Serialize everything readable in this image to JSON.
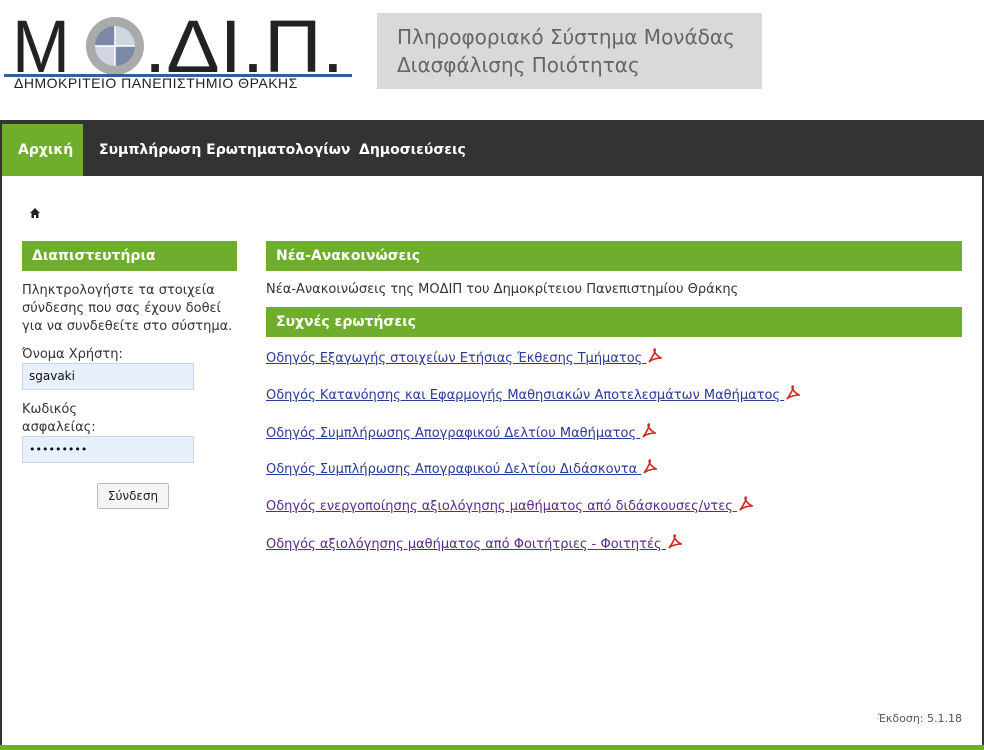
{
  "header": {
    "logo_text": "Μ.ΔΙ.Π.",
    "logo_subtitle": "ΔΗΜΟΚΡΙΤΕΙΟ ΠΑΝΕΠΙΣΤΗΜΙΟ ΘΡΑΚΗΣ",
    "system_title_line1": "Πληροφοριακό Σύστημα Μονάδας",
    "system_title_line2": "Διασφάλισης Ποιότητας"
  },
  "nav": {
    "items": [
      {
        "label": "Αρχική",
        "active": true
      },
      {
        "label": "Συμπλήρωση Ερωτηματολογίων",
        "active": false
      },
      {
        "label": "Δημοσιεύσεις",
        "active": false
      }
    ]
  },
  "breadcrumb": {
    "home_icon": "home-icon"
  },
  "login": {
    "title": "Διαπιστευτήρια",
    "intro": "Πληκτρολογήστε τα στοιχεία σύνδεσης που σας έχουν δοθεί για να συνδεθείτε στο σύστημα.",
    "username_label": "Όνομα Χρήστη:",
    "username_value": "sgavaki",
    "password_label_line1": "Κωδικός",
    "password_label_line2": "ασφαλείας:",
    "password_value": "•••••••••",
    "submit_label": "Σύνδεση"
  },
  "announcements": {
    "title": "Νέα-Ανακοινώσεις",
    "text": "Νέα-Ανακοινώσεις της ΜΟΔΙΠ του Δημοκρίτειου Πανεπιστημίου Θράκης"
  },
  "faq": {
    "title": "Συχνές ερωτήσεις",
    "links": [
      {
        "label": "Οδηγός Εξαγωγής στοιχείων Ετήσιας Έκθεσης Τμήματος",
        "icon": "pdf-icon",
        "visited": false
      },
      {
        "label": "Οδηγός Κατανόησης και Εφαρμογής Μαθησιακών Αποτελεσμάτων Μαθήματος",
        "icon": "pdf-icon",
        "visited": false
      },
      {
        "label": "Οδηγός Συμπλήρωσης Απογραφικού Δελτίου Μαθήματος",
        "icon": "pdf-icon",
        "visited": false
      },
      {
        "label": "Οδηγός Συμπλήρωσης Απογραφικού Δελτίου Διδάσκοντα",
        "icon": "pdf-icon",
        "visited": false
      },
      {
        "label": "Οδηγός ενεργοποίησης αξιολόγησης μαθήματος από διδάσκουσες/ντες",
        "icon": "pdf-icon",
        "visited": true
      },
      {
        "label": "Οδηγός αξιολόγησης μαθήματος από Φοιτήτριες - Φοιτητές",
        "icon": "pdf-icon",
        "visited": true
      }
    ]
  },
  "footer": {
    "version": "Έκδοση: 5.1.18"
  },
  "colors": {
    "accent": "#6fae2c",
    "nav_bg": "#333333",
    "link": "#2a3a9a",
    "visited": "#5a2a8a"
  }
}
